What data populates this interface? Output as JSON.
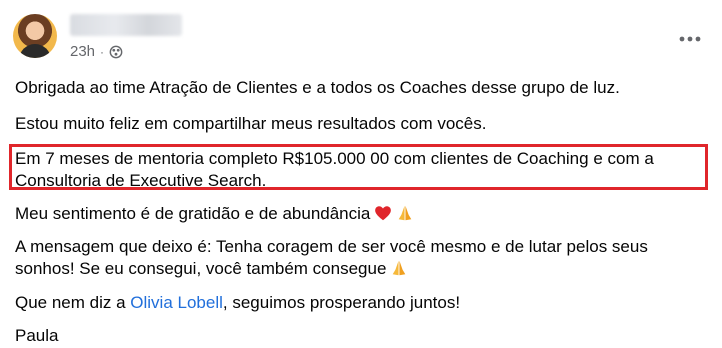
{
  "post": {
    "timestamp": "23h",
    "separator": "·",
    "icons": {
      "audience": "public-globe-icon",
      "more": "more-dots-icon",
      "heart": "red-heart-emoji-icon",
      "pray": "folded-hands-emoji-icon"
    },
    "paragraphs": {
      "p1": "Obrigada ao time Atração de Clientes e a todos os Coaches desse grupo de luz.",
      "p2": "Estou muito feliz em compartilhar meus resultados com vocês.",
      "p3_line1": "Em 7 meses de mentoria completo R$105.000 00 com clientes de Coaching e com a",
      "p3_line2": "Consultoria de Executive Search.",
      "p4": "Meu sentimento é de gratidão e de abundância",
      "p5_line1": "A mensagem que deixo é: Tenha coragem de ser você mesmo e de lutar pelos seus",
      "p5_line2": "sonhos! Se eu consegui, você também consegue",
      "p6_before": "Que nem diz a ",
      "p6_mention": "Olivia Lobell",
      "p6_after": ", seguimos prosperando juntos!",
      "p7": "Paula"
    },
    "colors": {
      "highlight_border": "#e0262b",
      "mention": "#216fdb",
      "secondary_text": "#65676b"
    }
  }
}
